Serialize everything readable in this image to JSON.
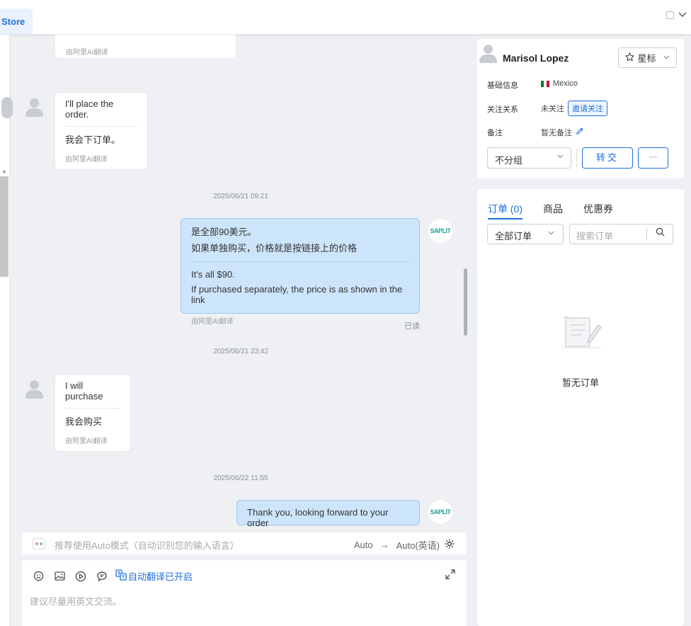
{
  "topbar": {
    "store_label": "Store"
  },
  "messages": [
    {
      "note": "由阿里AI翻译"
    },
    {
      "en": "I'll place the order.",
      "zh": "我会下订单。",
      "note": "由阿里AI翻译"
    },
    {
      "timestamp": "2025/06/21 09:21"
    },
    {
      "zh_line1": "是全部90美元。",
      "zh_line2": "如果单独购买，价格就是按链接上的价格",
      "en_line1": "It's all $90.",
      "en_line2": "If purchased separately, the price is as shown in the link",
      "note": "由阿里AI翻译",
      "status": "已读",
      "sender_logo": "SAPLIT"
    },
    {
      "timestamp": "2025/06/21 23:42"
    },
    {
      "en": "I will purchase",
      "zh": "我会购买",
      "note": "由阿里AI翻译"
    },
    {
      "timestamp": "2025/06/22 11:55"
    },
    {
      "text": "Thank you, looking forward to your order",
      "sender_logo": "SAPLIT"
    }
  ],
  "translation_bar": {
    "hint": "推荐使用Auto模式（自动识别您的输入语言）",
    "from": "Auto",
    "arrow": "→",
    "to": "Auto(英语)"
  },
  "composer": {
    "auto_translate_label": "自动翻译已开启",
    "placeholder": "建议尽量用英文交流。"
  },
  "profile": {
    "name": "Marisol Lopez",
    "star_label": "星标",
    "rows": [
      {
        "label": "基础信息",
        "value": "Mexico"
      },
      {
        "label": "关注关系",
        "value": "未关注",
        "action": "邀请关注"
      },
      {
        "label": "备注",
        "value": "暂无备注"
      }
    ],
    "group_select": "不分组",
    "transfer_label": "转交",
    "more_label": "···"
  },
  "orders": {
    "tabs": [
      {
        "label": "订单 (0)"
      },
      {
        "label": "商品"
      },
      {
        "label": "优惠券"
      }
    ],
    "filter_select": "全部订单",
    "search_placeholder": "搜索订单",
    "empty_text": "暂无订单"
  },
  "colors": {
    "accent": "#1f6fe0",
    "mine_bubble": "#cde5fb",
    "logo_green": "#1aa39a"
  }
}
